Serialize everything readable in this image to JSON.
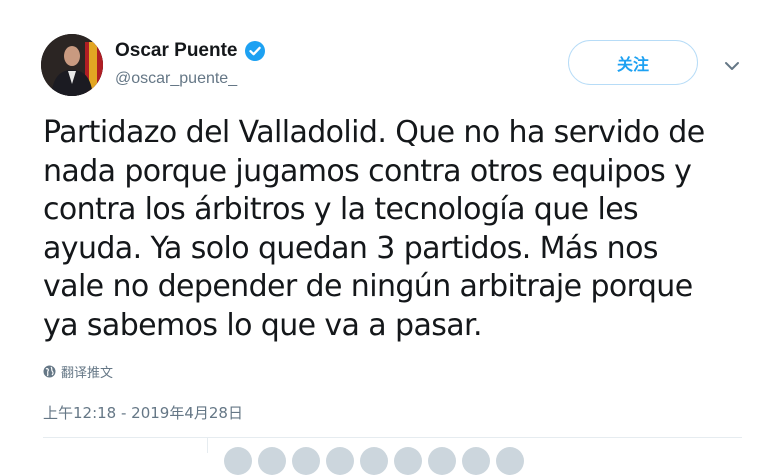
{
  "user": {
    "display_name": "Oscar Puente",
    "handle": "@oscar_puente_",
    "verified": true
  },
  "follow_label": "关注",
  "tweet": {
    "text": "Partidazo del Valladolid. Que no ha servido de\nnada porque jugamos contra otros equipos y\ncontra los árbitros y la tecnología que les\nayuda. Ya solo quedan 3 partidos. Más nos\nvale no depender de ningún arbitraje porque\nya sabemos lo que va a pasar.",
    "translate_label": "翻译推文",
    "timestamp": "上午12:18 - 2019年4月28日"
  },
  "colors": {
    "accent": "#1da1f2",
    "secondary_text": "#657786",
    "primary_text": "#14171a",
    "divider": "#e6ecf0"
  },
  "icons": [
    "verified-badge-icon",
    "chevron-down-icon",
    "globe-icon"
  ]
}
